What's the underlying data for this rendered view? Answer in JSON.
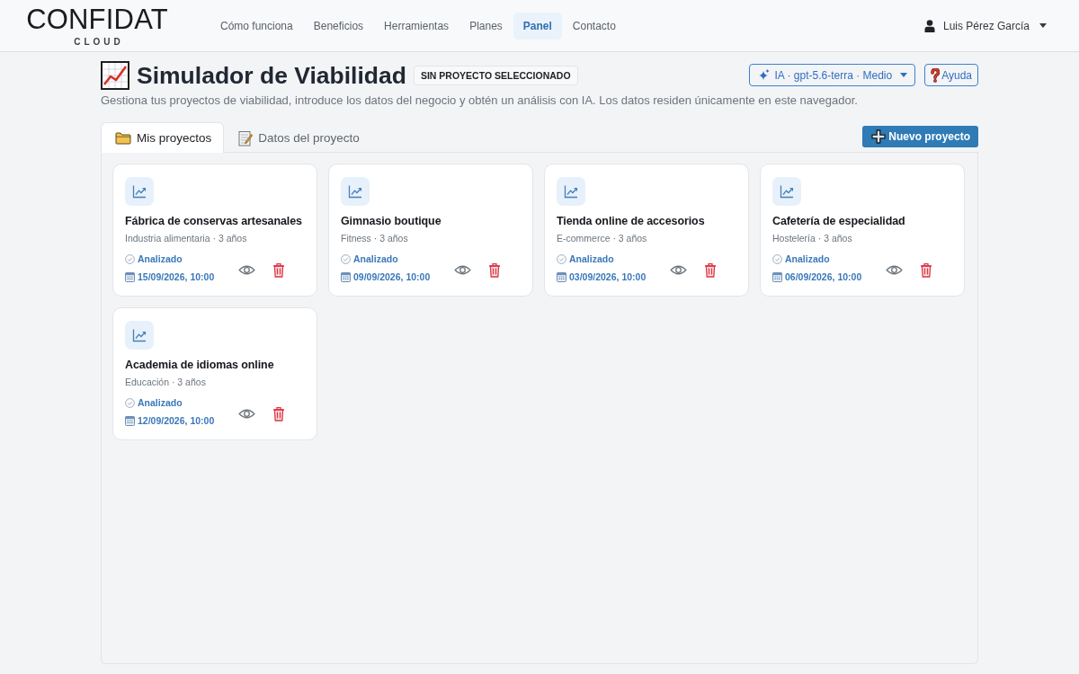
{
  "brand": {
    "name": "CONFIDAT",
    "tagline": "CLOUD"
  },
  "nav": {
    "links": [
      {
        "label": "Cómo funciona",
        "selected": false
      },
      {
        "label": "Beneficios",
        "selected": false
      },
      {
        "label": "Herramientas",
        "selected": false
      },
      {
        "label": "Planes",
        "selected": false
      },
      {
        "label": "Panel",
        "selected": true
      },
      {
        "label": "Contacto",
        "selected": false
      }
    ]
  },
  "user": {
    "name": "Luis Pérez García"
  },
  "header": {
    "title": "Simulador de Viabilidad",
    "badge": "SIN PROYECTO SELECCIONADO",
    "model_button": "IA · gpt-5.6-terra · Medio",
    "help_button": "Ayuda",
    "description": "Gestiona tus proyectos de viabilidad, introduce los datos del negocio y obtén un análisis con IA. Los datos residen únicamente en este navegador."
  },
  "tabs": [
    {
      "label": "Mis proyectos",
      "kind": "folder",
      "selected": true
    },
    {
      "label": "Datos del proyecto",
      "kind": "memo",
      "selected": false
    }
  ],
  "new_project_button": "Nuevo proyecto",
  "projects": [
    {
      "name": "Fábrica de conservas artesanales",
      "meta": "Industria alimentaria · 3 años",
      "status": "Analizado",
      "date": "15/09/2026, 10:00"
    },
    {
      "name": "Gimnasio boutique",
      "meta": "Fitness · 3 años",
      "status": "Analizado",
      "date": "09/09/2026, 10:00"
    },
    {
      "name": "Tienda online de accesorios",
      "meta": "E-commerce · 3 años",
      "status": "Analizado",
      "date": "03/09/2026, 10:00"
    },
    {
      "name": "Cafetería de especialidad",
      "meta": "Hostelería · 3 años",
      "status": "Analizado",
      "date": "06/09/2026, 10:00"
    },
    {
      "name": "Academia de idiomas online",
      "meta": "Educación · 3 años",
      "status": "Analizado",
      "date": "12/09/2026, 10:00"
    }
  ]
}
